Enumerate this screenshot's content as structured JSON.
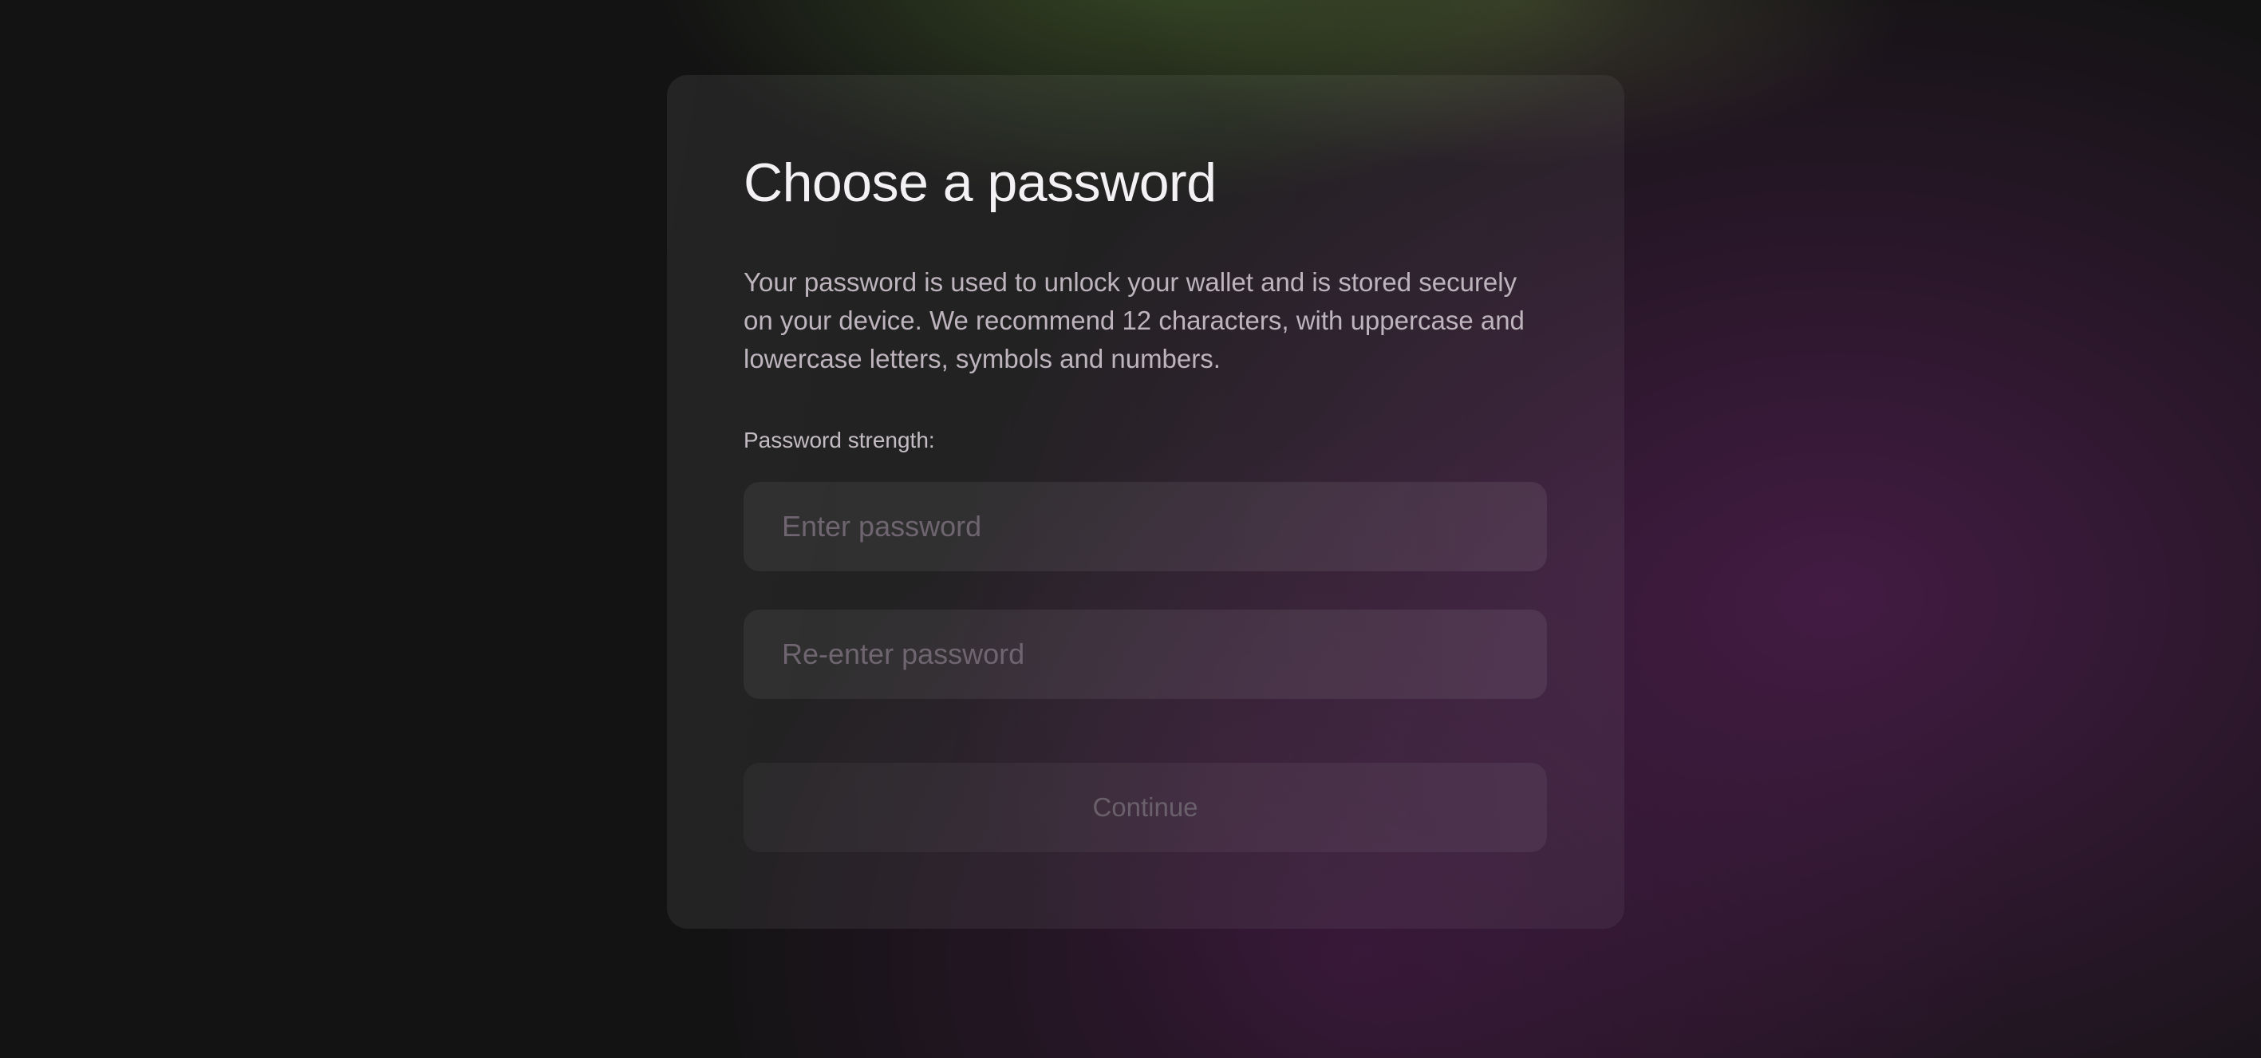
{
  "form": {
    "title": "Choose a password",
    "description": "Your password is used to unlock your wallet and is stored securely on your device. We recommend 12 characters, with uppercase and lowercase letters, symbols and numbers.",
    "strength_label": "Password strength:",
    "password_placeholder": "Enter password",
    "password_value": "",
    "confirm_placeholder": "Re-enter password",
    "confirm_value": "",
    "continue_label": "Continue"
  }
}
